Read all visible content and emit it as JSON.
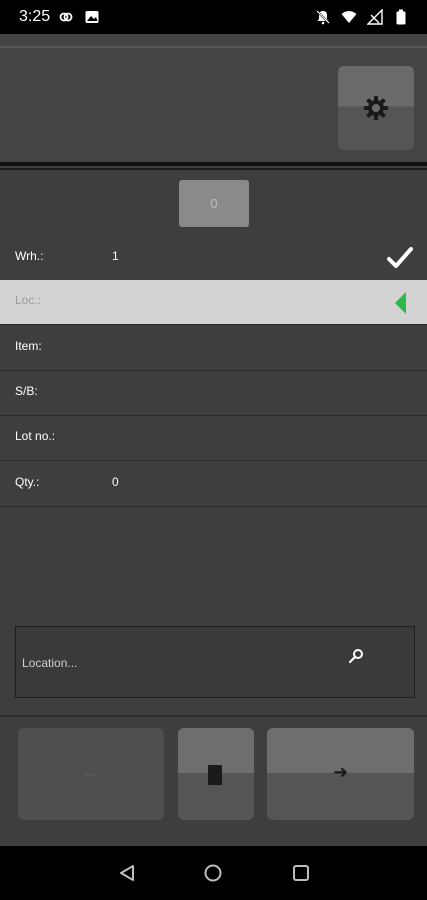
{
  "status_bar": {
    "time": "3:25",
    "left_icons": [
      "link-icon",
      "image-icon"
    ],
    "right_icons": [
      "notifications-off-icon",
      "wifi-icon",
      "signal-icon",
      "battery-icon"
    ]
  },
  "header": {
    "settings_icon": "gear-icon"
  },
  "counter": {
    "value": "0"
  },
  "form": {
    "rows": [
      {
        "label": "Wrh.:",
        "value": "1",
        "status_icon": "check-icon"
      },
      {
        "label": "Loc.:",
        "value": "",
        "status_icon": "active-pointer-icon",
        "active": true
      },
      {
        "label": "Item:",
        "value": ""
      },
      {
        "label": "S/B:",
        "value": ""
      },
      {
        "label": "Lot no.:",
        "value": ""
      },
      {
        "label": "Qty.:",
        "value": "0"
      }
    ]
  },
  "location_input": {
    "placeholder": "Location...",
    "value": "",
    "search_icon": "search-icon"
  },
  "actions": {
    "back_icon": "arrow-left-icon",
    "back_glyph": "←",
    "mid_icon": "stop-icon",
    "next_icon": "arrow-right-icon",
    "next_glyph": "➜"
  },
  "colors": {
    "background": "#3e3e3e",
    "active_row": "#d3d3d3",
    "accent_green": "#2fb84a"
  },
  "navigation": {
    "back": "nav-back-icon",
    "home": "nav-home-icon",
    "recents": "nav-recents-icon"
  }
}
